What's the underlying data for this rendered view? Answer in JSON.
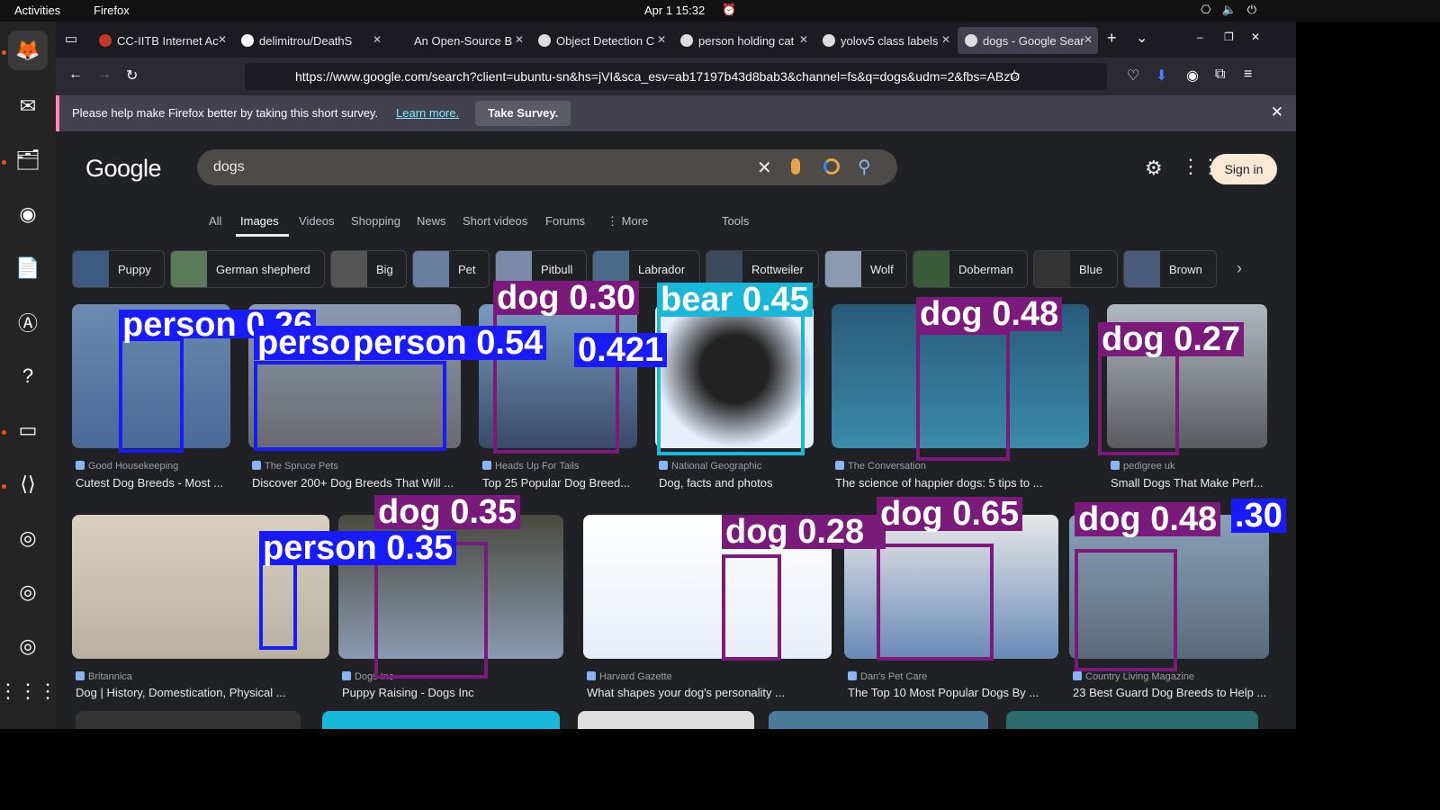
{
  "topbar": {
    "activities": "Activities",
    "app": "Firefox",
    "clock": "Apr 1  15:32"
  },
  "tabs": [
    {
      "title": "CC-IITB Internet Ac"
    },
    {
      "title": "delimitrou/DeathS"
    },
    {
      "title": "An Open-Source B"
    },
    {
      "title": "Object Detection C"
    },
    {
      "title": "person holding cat"
    },
    {
      "title": "yolov5 class labels"
    },
    {
      "title": "dogs - Google Sear"
    }
  ],
  "navbar": {
    "url": "https://www.google.com/search?client=ubuntu-sn&hs=jVI&sca_esv=ab17197b43d8bab3&channel=fs&q=dogs&udm=2&fbs=ABzO"
  },
  "notice": {
    "text": "Please help make Firefox better by taking this short survey.",
    "link": "Learn more.",
    "button": "Take Survey."
  },
  "google": {
    "logo": "Google",
    "query": "dogs",
    "signin": "Sign in"
  },
  "filters": [
    "All",
    "Images",
    "Videos",
    "Shopping",
    "News",
    "Short videos",
    "Forums",
    "⋮ More",
    "Tools"
  ],
  "chips": [
    "Puppy",
    "German shepherd",
    "Big",
    "Pet",
    "Pitbull",
    "Labrador",
    "Rottweiler",
    "Wolf",
    "Doberman",
    "Blue",
    "Brown"
  ],
  "results": [
    {
      "source": "Good Housekeeping",
      "caption": "Cutest Dog Breeds - Most ..."
    },
    {
      "source": "The Spruce Pets",
      "caption": "Discover 200+ Dog Breeds That Will ..."
    },
    {
      "source": "Heads Up For Tails",
      "caption": "Top 25 Popular Dog Breed..."
    },
    {
      "source": "National Geographic",
      "caption": "Dog, facts and photos"
    },
    {
      "source": "The Conversation",
      "caption": "The science of happier dogs: 5 tips to ..."
    },
    {
      "source": "pedigree uk",
      "caption": "Small Dogs That Make Perf..."
    },
    {
      "source": "Britannica",
      "caption": "Dog | History, Domestication, Physical ..."
    },
    {
      "source": "Dogs Inc",
      "caption": "Puppy Raising - Dogs Inc"
    },
    {
      "source": "Harvard Gazette",
      "caption": "What shapes your dog's personality ..."
    },
    {
      "source": "Dan's Pet Care",
      "caption": "The Top 10 Most Popular Dogs By ..."
    },
    {
      "source": "Country Living Magazine",
      "caption": "23 Best Guard Dog Breeds to Help ..."
    }
  ],
  "detections": [
    "person 0.26",
    "person 0.54",
    "person 0.44",
    "0.421",
    "dog 0.30",
    "bear 0.45",
    "dog 0.48",
    "dog 0.27",
    "dog 0.35",
    "person 0.35",
    "dog 0.28",
    "dog 0.65",
    "dog 0.48",
    ".30"
  ]
}
